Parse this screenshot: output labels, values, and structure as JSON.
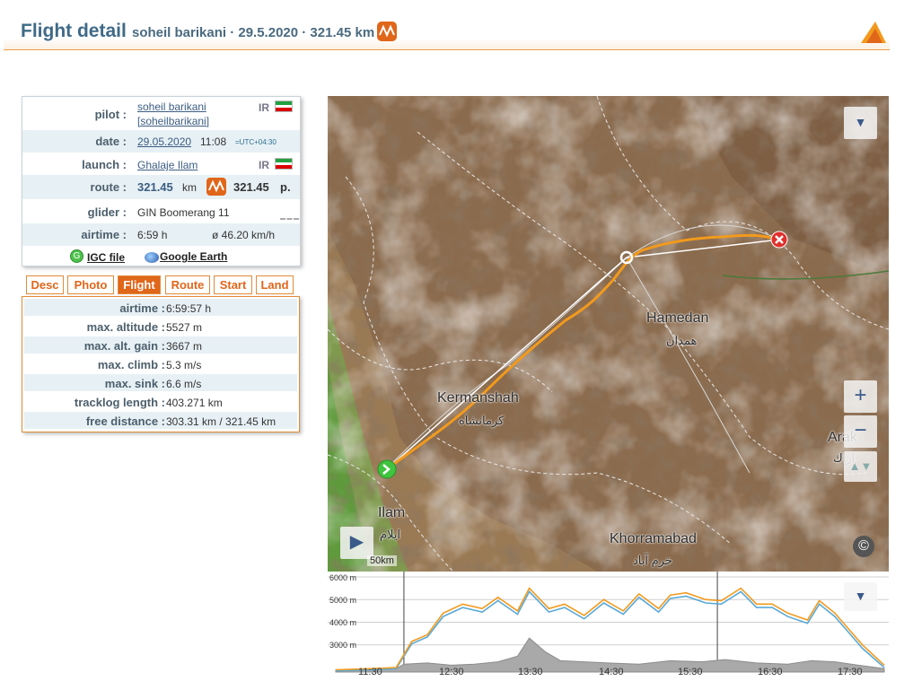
{
  "header": {
    "title": "Flight detail",
    "subtitle": "soheil barikani · 29.5.2020 · 321.45 km"
  },
  "info": {
    "pilot_label": "pilot :",
    "pilot_name": "soheil barikani",
    "pilot_username": "[soheilbarikani]",
    "pilot_country": "IR",
    "date_label": "date :",
    "date": "29.05.2020",
    "time": "11:08",
    "timezone": "=UTC+04:30",
    "launch_label": "launch :",
    "launch": "Ghalaje Ilam",
    "launch_country": "IR",
    "route_label": "route :",
    "route_km": "321.45",
    "route_unit": "km",
    "route_points": "321.45",
    "route_points_unit": "p.",
    "glider_label": "glider :",
    "glider": "GIN Boomerang 11",
    "airtime_label": "airtime :",
    "airtime": "6:59 h",
    "avg_speed": "ø 46.20 km/h",
    "igc_icon_letter": "G",
    "igc_link": "IGC file",
    "google_earth_link": "Google Earth"
  },
  "tabs": [
    {
      "label": "Desc"
    },
    {
      "label": "Photo"
    },
    {
      "label": "Flight"
    },
    {
      "label": "Route"
    },
    {
      "label": "Start"
    },
    {
      "label": "Land"
    }
  ],
  "active_tab": "Flight",
  "stats": [
    {
      "label": "airtime :",
      "value": "6:59:57 h"
    },
    {
      "label": "max. altitude :",
      "value": "5527 m"
    },
    {
      "label": "max. alt. gain :",
      "value": "3667 m"
    },
    {
      "label": "max. climb :",
      "value": "5.3 m/s"
    },
    {
      "label": "max. sink :",
      "value": "6.6 m/s"
    },
    {
      "label": "tracklog length :",
      "value": "403.271 km"
    },
    {
      "label": "free distance :",
      "value": "303.31 km / 321.45 km"
    }
  ],
  "map": {
    "cities": [
      {
        "name": "Hamedan",
        "name_fa": "همدان"
      },
      {
        "name": "Kermanshah",
        "name_fa": "كرمانشاه"
      },
      {
        "name": "Arak",
        "name_fa": "اراك"
      },
      {
        "name": "Ilam",
        "name_fa": "ايلام"
      },
      {
        "name": "Khorramabad",
        "name_fa": "خرم آباد"
      }
    ],
    "scale": "50km",
    "zoom_in": "+",
    "zoom_out": "−",
    "copyright": "©",
    "dropdown": "▼",
    "play": "▶",
    "track_color": "#f29a1d",
    "start_marker_color": "#3fc43f",
    "end_marker_color": "#e0302c"
  },
  "chart_data": {
    "type": "line",
    "x_ticks": [
      "11:30",
      "12:30",
      "13:30",
      "14:30",
      "15:30",
      "16:30",
      "17:30"
    ],
    "y_ticks": [
      "6000 m",
      "5000 m",
      "4000 m",
      "3000 m"
    ],
    "ylim": [
      1800,
      6000
    ],
    "x_hours": [
      11.13,
      18.13
    ],
    "series": [
      {
        "color": "#f29a1d",
        "x": [
          11.13,
          11.6,
          11.9,
          12.1,
          12.3,
          12.5,
          12.75,
          13.0,
          13.2,
          13.45,
          13.6,
          13.85,
          14.05,
          14.3,
          14.55,
          14.8,
          15.0,
          15.25,
          15.4,
          15.6,
          15.85,
          16.05,
          16.3,
          16.5,
          16.7,
          16.9,
          17.15,
          17.3,
          17.5,
          17.7,
          17.85,
          18.13
        ],
        "values": [
          1900,
          1950,
          2000,
          3150,
          3450,
          4400,
          4800,
          4600,
          5100,
          4500,
          5500,
          4600,
          4800,
          4300,
          5000,
          4500,
          5250,
          4600,
          5200,
          5300,
          5000,
          4950,
          5500,
          4800,
          4800,
          4400,
          4100,
          4950,
          4400,
          3600,
          3000,
          2100
        ]
      },
      {
        "color": "#5aa9d6",
        "x": [
          11.13,
          11.6,
          11.9,
          12.1,
          12.3,
          12.5,
          12.75,
          13.0,
          13.2,
          13.45,
          13.6,
          13.85,
          14.05,
          14.3,
          14.55,
          14.8,
          15.0,
          15.25,
          15.4,
          15.6,
          15.85,
          16.05,
          16.3,
          16.5,
          16.7,
          16.9,
          17.15,
          17.3,
          17.5,
          17.7,
          17.85,
          18.13
        ],
        "values": [
          1850,
          1900,
          1950,
          3050,
          3350,
          4250,
          4650,
          4450,
          4950,
          4350,
          5350,
          4450,
          4650,
          4150,
          4850,
          4350,
          5100,
          4450,
          5050,
          5150,
          4850,
          4800,
          5350,
          4650,
          4650,
          4250,
          3950,
          4800,
          4250,
          3450,
          2850,
          2000
        ]
      },
      {
        "color": "#8c8c8c",
        "x": [
          11.13,
          11.9,
          12.0,
          12.3,
          12.6,
          12.9,
          13.2,
          13.45,
          13.6,
          13.8,
          14.0,
          14.3,
          14.6,
          15.0,
          15.4,
          15.8,
          16.1,
          16.5,
          16.9,
          17.2,
          17.5,
          17.8,
          18.13
        ],
        "values": [
          1900,
          1950,
          2150,
          2200,
          2100,
          2150,
          2250,
          2500,
          3300,
          2700,
          2300,
          2250,
          2200,
          2150,
          2300,
          2250,
          2350,
          2200,
          2150,
          2300,
          2250,
          2100,
          1950
        ]
      }
    ]
  }
}
